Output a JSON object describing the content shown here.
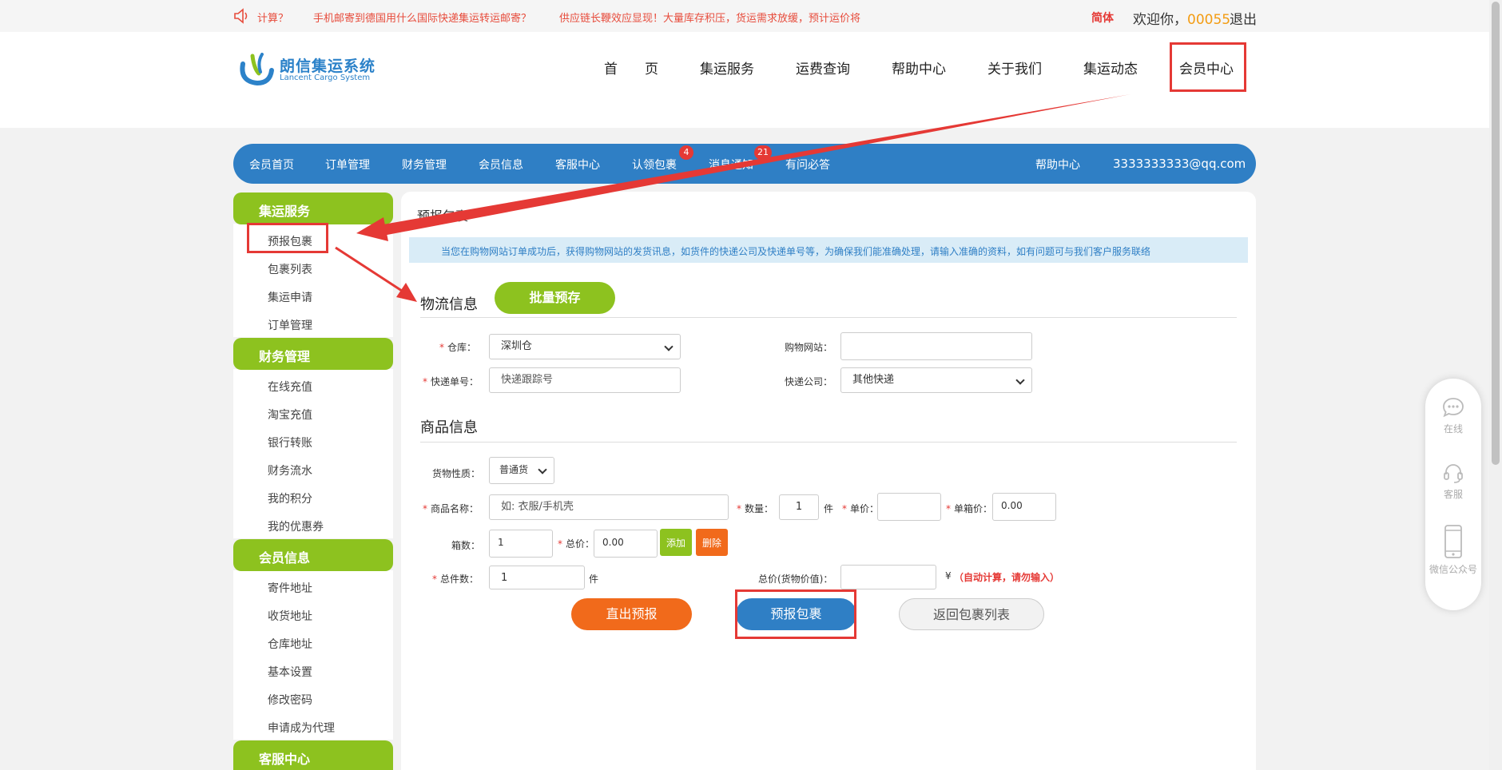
{
  "topbar": {
    "notices": [
      "计算？",
      "手机邮寄到德国用什么国际快递集运转运邮寄？",
      "供应链长鞭效应显现！大量库存积压，货运需求放缓，预计运价将"
    ],
    "lang": "简体",
    "welcome": "欢迎你，",
    "user_id": "00055",
    "logout": "退出"
  },
  "logo": {
    "name_cn": "朗信集运系统",
    "name_en": "Lancent Cargo System"
  },
  "main_nav": [
    "首　　页",
    "集运服务",
    "运费查询",
    "帮助中心",
    "关于我们",
    "集运动态",
    "会员中心"
  ],
  "member_nav": {
    "items": [
      "会员首页",
      "订单管理",
      "财务管理",
      "会员信息",
      "客服中心",
      "认领包裹",
      "消息通知",
      "有问必答"
    ],
    "badges": {
      "claim": "4",
      "messages": "21"
    },
    "help": "帮助中心",
    "email": "3333333333@qq.com"
  },
  "sidebar": {
    "sections": [
      {
        "title": "集运服务",
        "items": [
          "预报包裹",
          "包裹列表",
          "集运申请",
          "订单管理"
        ]
      },
      {
        "title": "财务管理",
        "items": [
          "在线充值",
          "淘宝充值",
          "银行转账",
          "财务流水",
          "我的积分",
          "我的优惠券"
        ]
      },
      {
        "title": "会员信息",
        "items": [
          "寄件地址",
          "收货地址",
          "仓库地址",
          "基本设置",
          "修改密码",
          "申请成为代理"
        ]
      },
      {
        "title": "客服中心",
        "items": []
      }
    ]
  },
  "main": {
    "breadcrumb": "预报包裹",
    "tip": "当您在购物网站订单成功后，获得购物网站的发货讯息，如货件的快递公司及快递单号等，为确保我们能准确处理，请输入准确的资料，如有问题可与我们客户服务联络",
    "logistics": {
      "title": "物流信息",
      "batch_btn": "批量预存",
      "warehouse_label": "仓库：",
      "warehouse_value": "深圳仓",
      "shop_site_label": "购物网站：",
      "shop_site_value": "",
      "tracking_label": "快递单号：",
      "tracking_placeholder": "快递跟踪号",
      "courier_label": "快递公司：",
      "courier_value": "其他快递"
    },
    "goods": {
      "title": "商品信息",
      "nature_label": "货物性质：",
      "nature_value": "普通货",
      "name_label": "商品名称：",
      "name_placeholder": "如: 衣服/手机壳",
      "qty_label": "数量：",
      "qty_value": "1",
      "qty_unit": "件",
      "price_label": "单价：",
      "price_value": "",
      "unit_box_price_label": "单箱价：",
      "unit_box_price_value": "0.00",
      "boxes_label": "箱数：",
      "boxes_value": "1",
      "total_label": "总价：",
      "total_value": "0.00",
      "add_btn": "添加",
      "delete_btn": "删除",
      "total_pieces_label": "总件数：",
      "total_pieces_value": "1",
      "total_pieces_unit": "件",
      "goods_value_label": "总价(货物价值)：",
      "goods_value_value": "",
      "currency": "¥",
      "auto_note": "（自动计算，请勿输入）"
    },
    "buttons": {
      "direct": "直出预报",
      "forecast": "预报包裹",
      "back": "返回包裹列表"
    }
  },
  "float_widget": [
    "在线",
    "客服",
    "微信公众号"
  ],
  "colors": {
    "blue": "#2f7fc5",
    "green": "#8dc21f",
    "orange": "#f16a1b",
    "red": "#e53935"
  }
}
